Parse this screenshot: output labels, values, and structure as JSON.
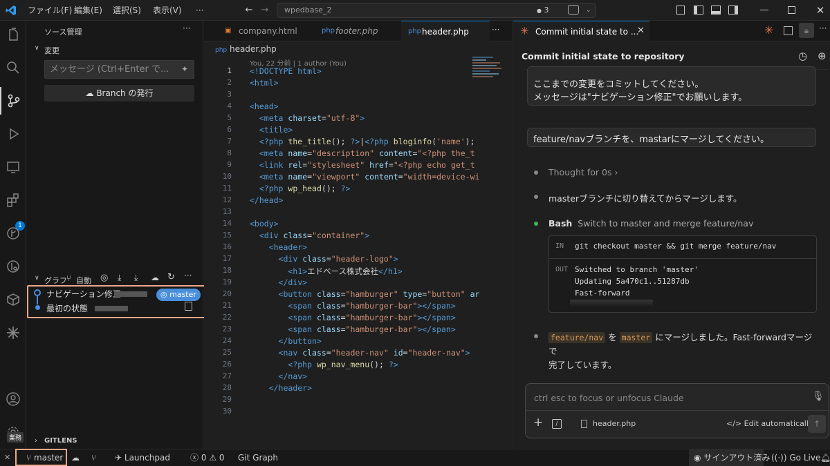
{
  "titlebar": {
    "menus": [
      "ファイル(F)",
      "編集(E)",
      "選択(S)",
      "表示(V)",
      "···"
    ],
    "search": "wpedbase_2",
    "agent_count": "3"
  },
  "activity": {
    "extensions_badge": "1",
    "tooltip": "業務"
  },
  "sidebar": {
    "title": "ソース管理",
    "changes_header": "変更",
    "message_placeholder": "メッセージ (Ctrl+Enter で...",
    "publish_button": "Branch の発行",
    "graph_header": "グラフ",
    "graph_auto": "自動",
    "commits": [
      {
        "message": "ナビゲーション修正",
        "branch": "master"
      },
      {
        "message": "最初の状態"
      }
    ],
    "gitlens_header": "GITLENS"
  },
  "editor": {
    "tabs": [
      "company.html",
      "footer.php",
      "header.php"
    ],
    "breadcrumb": "header.php",
    "blame": "You, 22 分前 | 1 author (You)",
    "line_numbers": [
      "1",
      "2",
      "3",
      "4",
      "5",
      "6",
      "7",
      "8",
      "9",
      "10",
      "11",
      "12",
      "13",
      "14",
      "15",
      "16",
      "17",
      "18",
      "19",
      "20",
      "21",
      "22",
      "23",
      "24",
      "25",
      "26",
      "27",
      "28",
      "29",
      "30"
    ]
  },
  "panel": {
    "tab_title": "Commit initial state to ...",
    "heading": "Commit initial state to repository",
    "user_msg1_line1": "ここまでの変更をコミットしてください。",
    "user_msg1_line2": "メッセージは\"ナビゲーション修正\"でお願いします。",
    "user_msg2": "feature/navブランチを、mastarにマージしてください。",
    "thought": "Thought for 0s",
    "assistant1": "masterブランチに切り替えてからマージします。",
    "tool_name": "Bash",
    "tool_desc": "Switch to master and merge feature/nav",
    "in_label": "IN",
    "in_cmd": "git checkout master && git merge feature/nav",
    "out_label": "OUT",
    "out_lines": [
      "Switched to branch 'master'",
      "Updating 5a470c1..51287db",
      "Fast-forward"
    ],
    "final_code1": "feature/nav",
    "final_mid": "を",
    "final_code2": "master",
    "final_text1": "にマージしました。Fast-forwardマージで",
    "final_text2": "完了しています。",
    "composer_placeholder": "ctrl esc to focus or unfocus Claude",
    "composer_file": "header.php",
    "composer_mode": "Edit automatically"
  },
  "status": {
    "branch": "master",
    "launchpad": "Launchpad",
    "errors": "0",
    "warnings": "0",
    "git_graph": "Git Graph",
    "signed_out": "サインアウト済み",
    "go_live": "Go Live"
  }
}
